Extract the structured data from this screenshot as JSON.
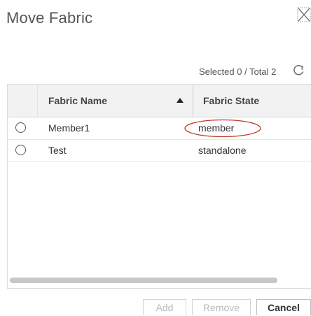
{
  "dialog": {
    "title": "Move Fabric",
    "close_icon": "close-x-icon"
  },
  "toolbar": {
    "selection_summary": "Selected 0 / Total 2",
    "refresh_icon": "refresh-icon"
  },
  "table": {
    "columns": [
      {
        "label": "Fabric Name",
        "sort": "ascending"
      },
      {
        "label": "Fabric State"
      }
    ],
    "rows": [
      {
        "name": "Member1",
        "state": "member",
        "selected": false,
        "state_highlighted": true
      },
      {
        "name": "Test",
        "state": "standalone",
        "selected": false,
        "state_highlighted": false
      }
    ]
  },
  "footer": {
    "add_label": "Add",
    "remove_label": "Remove",
    "cancel_label": "Cancel"
  },
  "colors": {
    "highlight_ellipse": "#c0392b",
    "disabled_text": "#b8b8b8",
    "header_bg": "#f2f2f2"
  }
}
